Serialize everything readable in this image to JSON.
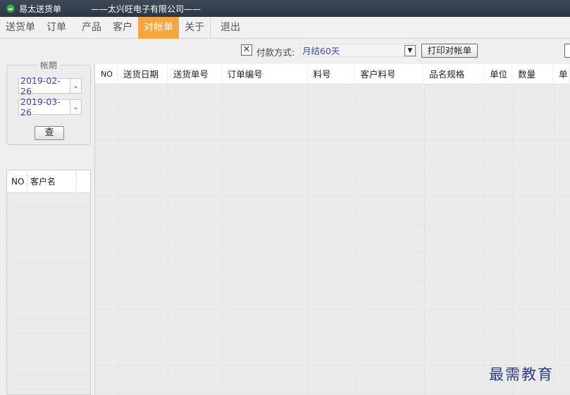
{
  "titlebar": {
    "app_title": "易太送货单",
    "company": "——太兴旺电子有限公司——"
  },
  "menu": {
    "items": [
      "送货单",
      "订单",
      "产品",
      "客户",
      "对帐单",
      "关于",
      "退出"
    ],
    "active": "对帐单"
  },
  "period": {
    "legend": "帐期",
    "start_date": "2019-02-26",
    "end_date": "2019-03-26",
    "query_label": "查"
  },
  "customer_table": {
    "headers": [
      "NO",
      "客户名"
    ]
  },
  "payment": {
    "checkbox_glyph": "✕",
    "label": "付款方式:",
    "value": "月结60天"
  },
  "print_label": "打印对帐单",
  "main_table": {
    "headers": [
      "NO",
      "送货日期",
      "送货单号",
      "订单编号",
      "料号",
      "客户料号",
      "品名规格",
      "单位",
      "数量",
      "单"
    ]
  },
  "watermark": "最需教育",
  "colors": {
    "active_menu": "#f7a541",
    "titlebar": "#333e4a",
    "value_text": "#3c45b8"
  }
}
